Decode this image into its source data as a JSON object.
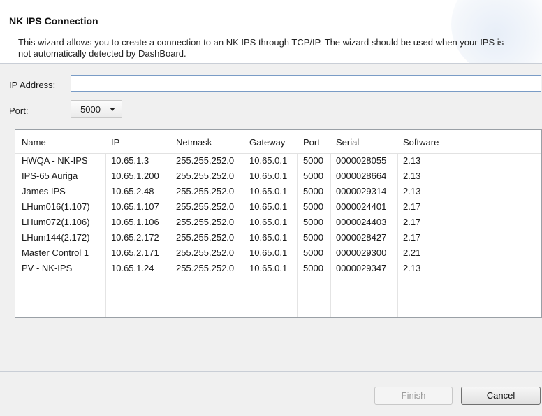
{
  "header": {
    "title": "NK IPS Connection",
    "description": "This wizard allows you to create a connection to an NK IPS through TCP/IP.  The wizard should be used when your IPS is not automatically detected by DashBoard."
  },
  "form": {
    "ip_label": "IP Address:",
    "ip_value": "",
    "port_label": "Port:",
    "port_value": "5000"
  },
  "table": {
    "columns": [
      "Name",
      "IP",
      "Netmask",
      "Gateway",
      "Port",
      "Serial",
      "Software"
    ],
    "rows": [
      [
        "HWQA - NK-IPS",
        "10.65.1.3",
        "255.255.252.0",
        "10.65.0.1",
        "5000",
        "0000028055",
        "2.13"
      ],
      [
        "IPS-65 Auriga",
        "10.65.1.200",
        "255.255.252.0",
        "10.65.0.1",
        "5000",
        "0000028664",
        "2.13"
      ],
      [
        "James IPS",
        "10.65.2.48",
        "255.255.252.0",
        "10.65.0.1",
        "5000",
        "0000029314",
        "2.13"
      ],
      [
        "LHum016(1.107)",
        "10.65.1.107",
        "255.255.252.0",
        "10.65.0.1",
        "5000",
        "0000024401",
        "2.17"
      ],
      [
        "LHum072(1.106)",
        "10.65.1.106",
        "255.255.252.0",
        "10.65.0.1",
        "5000",
        "0000024403",
        "2.17"
      ],
      [
        "LHum144(2.172)",
        "10.65.2.172",
        "255.255.252.0",
        "10.65.0.1",
        "5000",
        "0000028427",
        "2.17"
      ],
      [
        "Master Control 1",
        "10.65.2.171",
        "255.255.252.0",
        "10.65.0.1",
        "5000",
        "0000029300",
        "2.21"
      ],
      [
        "PV - NK-IPS",
        "10.65.1.24",
        "255.255.252.0",
        "10.65.0.1",
        "5000",
        "0000029347",
        "2.13"
      ]
    ]
  },
  "buttons": {
    "finish": "Finish",
    "cancel": "Cancel"
  }
}
